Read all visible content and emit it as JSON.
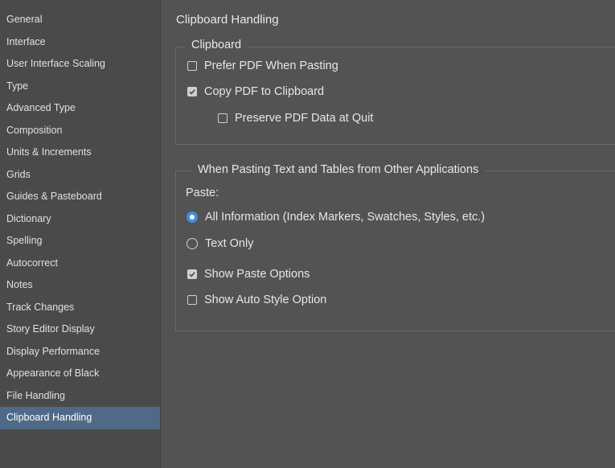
{
  "sidebar": {
    "items": [
      {
        "label": "General"
      },
      {
        "label": "Interface"
      },
      {
        "label": "User Interface Scaling"
      },
      {
        "label": "Type"
      },
      {
        "label": "Advanced Type"
      },
      {
        "label": "Composition"
      },
      {
        "label": "Units & Increments"
      },
      {
        "label": "Grids"
      },
      {
        "label": "Guides & Pasteboard"
      },
      {
        "label": "Dictionary"
      },
      {
        "label": "Spelling"
      },
      {
        "label": "Autocorrect"
      },
      {
        "label": "Notes"
      },
      {
        "label": "Track Changes"
      },
      {
        "label": "Story Editor Display"
      },
      {
        "label": "Display Performance"
      },
      {
        "label": "Appearance of Black"
      },
      {
        "label": "File Handling"
      },
      {
        "label": "Clipboard Handling"
      }
    ],
    "active_index": 18
  },
  "page": {
    "title": "Clipboard Handling"
  },
  "clipboard_group": {
    "legend": "Clipboard",
    "prefer_pdf": {
      "label": "Prefer PDF When Pasting",
      "checked": false
    },
    "copy_pdf": {
      "label": "Copy PDF to Clipboard",
      "checked": true
    },
    "preserve_pdf": {
      "label": "Preserve PDF Data at Quit",
      "checked": false
    }
  },
  "paste_group": {
    "legend": "When Pasting Text and Tables from Other Applications",
    "paste_label": "Paste:",
    "all_info": {
      "label": "All Information (Index Markers, Swatches, Styles, etc.)",
      "selected": true
    },
    "text_only": {
      "label": "Text Only",
      "selected": false
    },
    "show_paste_options": {
      "label": "Show Paste Options",
      "checked": true
    },
    "show_auto_style": {
      "label": "Show Auto Style Option",
      "checked": false
    }
  },
  "colors": {
    "background": "#535353",
    "sidebar": "#4a4a4a",
    "selection": "#4f6a87",
    "accent": "#3d8ee6"
  }
}
